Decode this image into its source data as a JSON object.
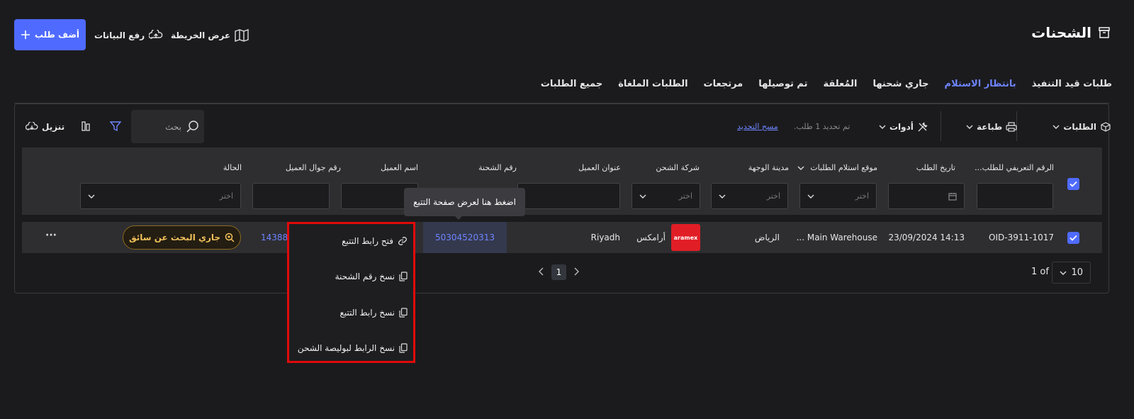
{
  "header": {
    "title": "الشحنات",
    "add_order": "أضف طلب",
    "upload_data": "رفع البيانات",
    "show_map": "عرض الخريطة"
  },
  "tabs": [
    {
      "label": "طلبات قيد التنفيذ",
      "active": false
    },
    {
      "label": "بانتظار الاستلام",
      "active": true
    },
    {
      "label": "جاري شحنها",
      "active": false
    },
    {
      "label": "المُعلقة",
      "active": false
    },
    {
      "label": "تم توصيلها",
      "active": false
    },
    {
      "label": "مرتجعات",
      "active": false
    },
    {
      "label": "الطلبات الملغاة",
      "active": false
    },
    {
      "label": "جميع الطلبات",
      "active": false
    }
  ],
  "toolbar": {
    "orders": "الطلبات",
    "print": "طباعة",
    "tools": "أدوات",
    "selection_info": "تم تحديد 1 طلب.",
    "clear_selection": "مسح التحديد",
    "search_placeholder": "بحث",
    "download": "تنزيل"
  },
  "table": {
    "columns": {
      "order_id": "الرقم التعريفي للطلب...",
      "order_date": "تاريخ الطلب",
      "pickup_location": "موقع استلام الطلبات",
      "destination_city": "مدينة الوجهة",
      "shipping_company": "شركة الشحن",
      "customer_address": "عنوان العميل",
      "tracking_number": "رقم الشحنة",
      "customer_name": "اسم العميل",
      "customer_phone": "رقم جوال العميل",
      "status": "الحالة"
    },
    "filter_placeholder": "اختر",
    "row": {
      "order_id": "OID-3911-1017",
      "order_date": "23/09/2024 14:13",
      "pickup_location": "Main Warehouse ...",
      "destination_city": "الرياض",
      "carrier_logo_text": "aramex",
      "shipping_company": "أرامكس",
      "customer_address": "Riyadh",
      "tracking_number": "50304520313",
      "customer_phone": "14388",
      "status": "جاري البحث عن سائق",
      "more": "···"
    }
  },
  "tooltip": "اضغط هنا لعرض صفحة التتبع",
  "context_menu": [
    {
      "label": "فتح رابط التتبع",
      "icon": "link-icon"
    },
    {
      "label": "نسخ رقم الشحنة",
      "icon": "copy-icon"
    },
    {
      "label": "نسخ رابط التتبع",
      "icon": "copy-icon"
    },
    {
      "label": "نسخ الرابط لبوليصة الشحن",
      "icon": "copy-icon"
    }
  ],
  "pagination": {
    "current_page": "1",
    "page_info": "1 of",
    "page_size": "10"
  },
  "colors": {
    "accent": "#4f6bff",
    "status": "#f0c05a",
    "highlight": "#e10a0a",
    "aramex": "#e11e26"
  }
}
